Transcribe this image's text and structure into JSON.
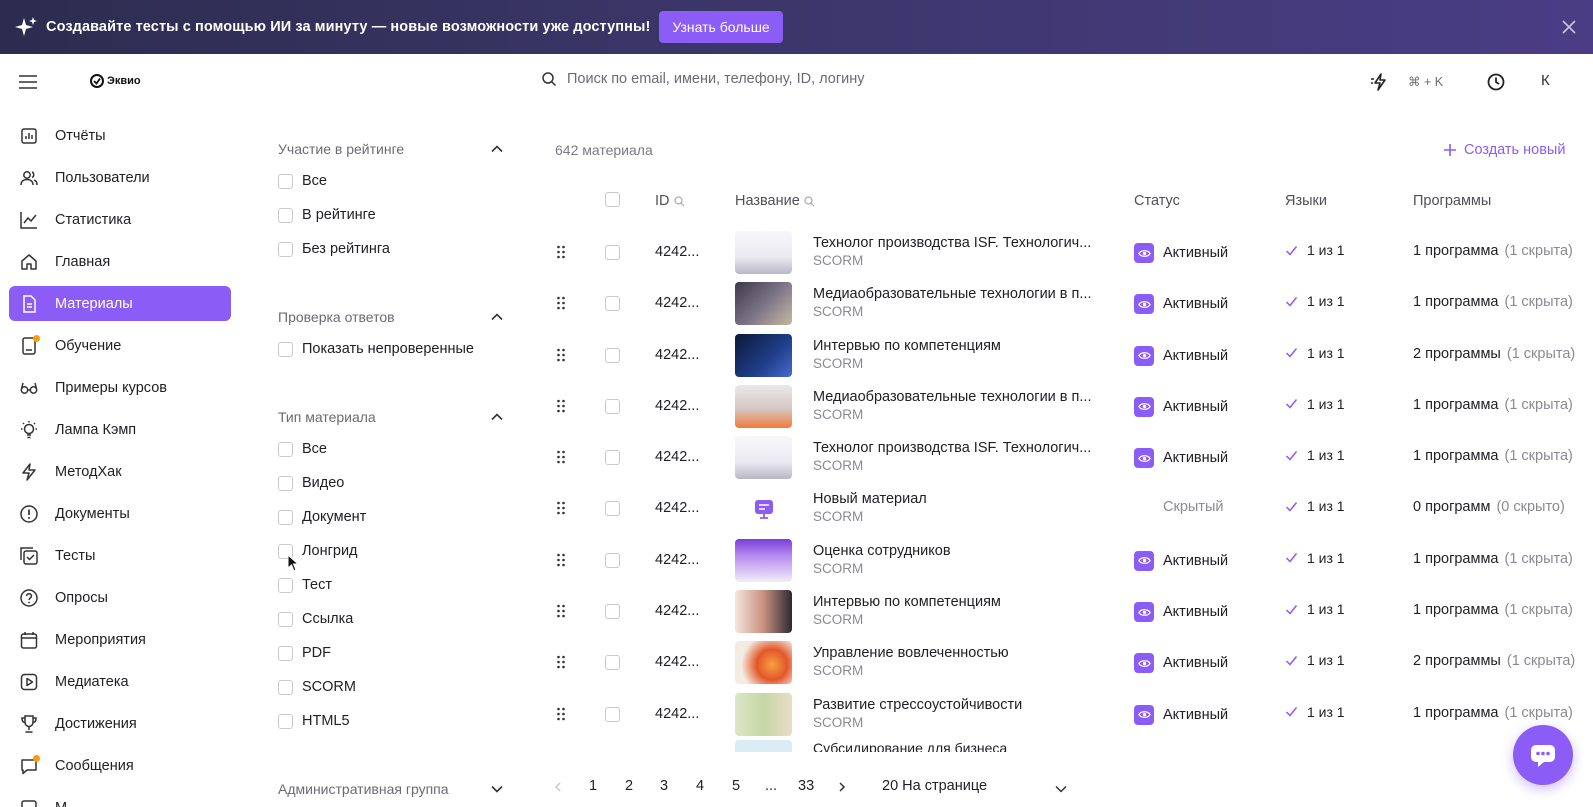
{
  "banner": {
    "text": "Создавайте тесты с помощью ИИ за минуту — новые возможности уже доступны!",
    "button": "Узнать больше"
  },
  "header": {
    "logo": "Эквио",
    "search_placeholder": "Поиск по email, имени, телефону, ID, логину",
    "shortcut": "⌘ + K",
    "avatar": "К"
  },
  "sidebar": {
    "items": [
      {
        "label": "Отчёты",
        "icon": "reports-icon"
      },
      {
        "label": "Пользователи",
        "icon": "users-icon"
      },
      {
        "label": "Статистика",
        "icon": "chart-icon"
      },
      {
        "label": "Главная",
        "icon": "home-icon"
      },
      {
        "label": "Материалы",
        "icon": "document-icon"
      },
      {
        "label": "Обучение",
        "icon": "learning-icon"
      },
      {
        "label": "Примеры курсов",
        "icon": "glasses-icon"
      },
      {
        "label": "Лампа Кэмп",
        "icon": "lamp-icon"
      },
      {
        "label": "МетодХак",
        "icon": "lightning-icon"
      },
      {
        "label": "Документы",
        "icon": "info-icon"
      },
      {
        "label": "Тесты",
        "icon": "tests-icon"
      },
      {
        "label": "Опросы",
        "icon": "survey-icon"
      },
      {
        "label": "Мероприятия",
        "icon": "calendar-icon"
      },
      {
        "label": "Медиатека",
        "icon": "play-icon"
      },
      {
        "label": "Достижения",
        "icon": "trophy-icon"
      },
      {
        "label": "Сообщения",
        "icon": "messages-icon"
      },
      {
        "label": "М",
        "icon": "more-icon"
      }
    ]
  },
  "filters": {
    "rating": {
      "title": "Участие в рейтинге",
      "options": [
        "Все",
        "В рейтинге",
        "Без рейтинга"
      ]
    },
    "check": {
      "title": "Проверка ответов",
      "options": [
        "Показать непроверенные"
      ]
    },
    "type": {
      "title": "Тип материала",
      "options": [
        "Все",
        "Видео",
        "Документ",
        "Лонгрид",
        "Тест",
        "Ссылка",
        "PDF",
        "SCORM",
        "HTML5"
      ]
    },
    "admin": {
      "title": "Административная группа"
    }
  },
  "main": {
    "count": "642 материала",
    "create": "Создать новый",
    "columns": {
      "id": "ID",
      "name": "Название",
      "status": "Статус",
      "languages": "Языки",
      "programs": "Программы"
    },
    "rows": [
      {
        "id": "4242...",
        "name": "Технолог производства ISF. Технологич...",
        "type": "SCORM",
        "status": "Активный",
        "lang": "1 из 1",
        "programs": "1 программа",
        "programs_note": "(1 скрыта)"
      },
      {
        "id": "4242...",
        "name": "Медиаобразовательные технологии в п...",
        "type": "SCORM",
        "status": "Активный",
        "lang": "1 из 1",
        "programs": "1 программа",
        "programs_note": "(1 скрыта)"
      },
      {
        "id": "4242...",
        "name": "Интервью по компетенциям",
        "type": "SCORM",
        "status": "Активный",
        "lang": "1 из 1",
        "programs": "2 программы",
        "programs_note": "(1 скрыта)"
      },
      {
        "id": "4242...",
        "name": "Медиаобразовательные технологии в п...",
        "type": "SCORM",
        "status": "Активный",
        "lang": "1 из 1",
        "programs": "1 программа",
        "programs_note": "(1 скрыта)"
      },
      {
        "id": "4242...",
        "name": "Технолог производства ISF. Технологич...",
        "type": "SCORM",
        "status": "Активный",
        "lang": "1 из 1",
        "programs": "1 программа",
        "programs_note": "(1 скрыта)"
      },
      {
        "id": "4242...",
        "name": "Новый материал",
        "type": "SCORM",
        "status": "Скрытый",
        "lang": "1 из 1",
        "programs": "0 программ",
        "programs_note": "(0 скрыто)"
      },
      {
        "id": "4242...",
        "name": "Оценка сотрудников",
        "type": "SCORM",
        "status": "Активный",
        "lang": "1 из 1",
        "programs": "1 программа",
        "programs_note": "(1 скрыта)"
      },
      {
        "id": "4242...",
        "name": "Интервью по компетенциям",
        "type": "SCORM",
        "status": "Активный",
        "lang": "1 из 1",
        "programs": "1 программа",
        "programs_note": "(1 скрыта)"
      },
      {
        "id": "4242...",
        "name": "Управление вовлеченностью",
        "type": "SCORM",
        "status": "Активный",
        "lang": "1 из 1",
        "programs": "2 программы",
        "programs_note": "(1 скрыта)"
      },
      {
        "id": "4242...",
        "name": "Развитие стрессоустойчивости",
        "type": "SCORM",
        "status": "Активный",
        "lang": "1 из 1",
        "programs": "1 программа",
        "programs_note": "(1 скрыта)"
      }
    ],
    "partial_row_name": "Субсидирование для бизнеса"
  },
  "pagination": {
    "pages": [
      "1",
      "2",
      "3",
      "4",
      "5",
      "...",
      "33"
    ],
    "per_page": "20 На странице"
  },
  "colors": {
    "accent": "#8b5cf6",
    "banner_bg": "#2c2c4f",
    "notification_dot": "#f59e0b"
  }
}
